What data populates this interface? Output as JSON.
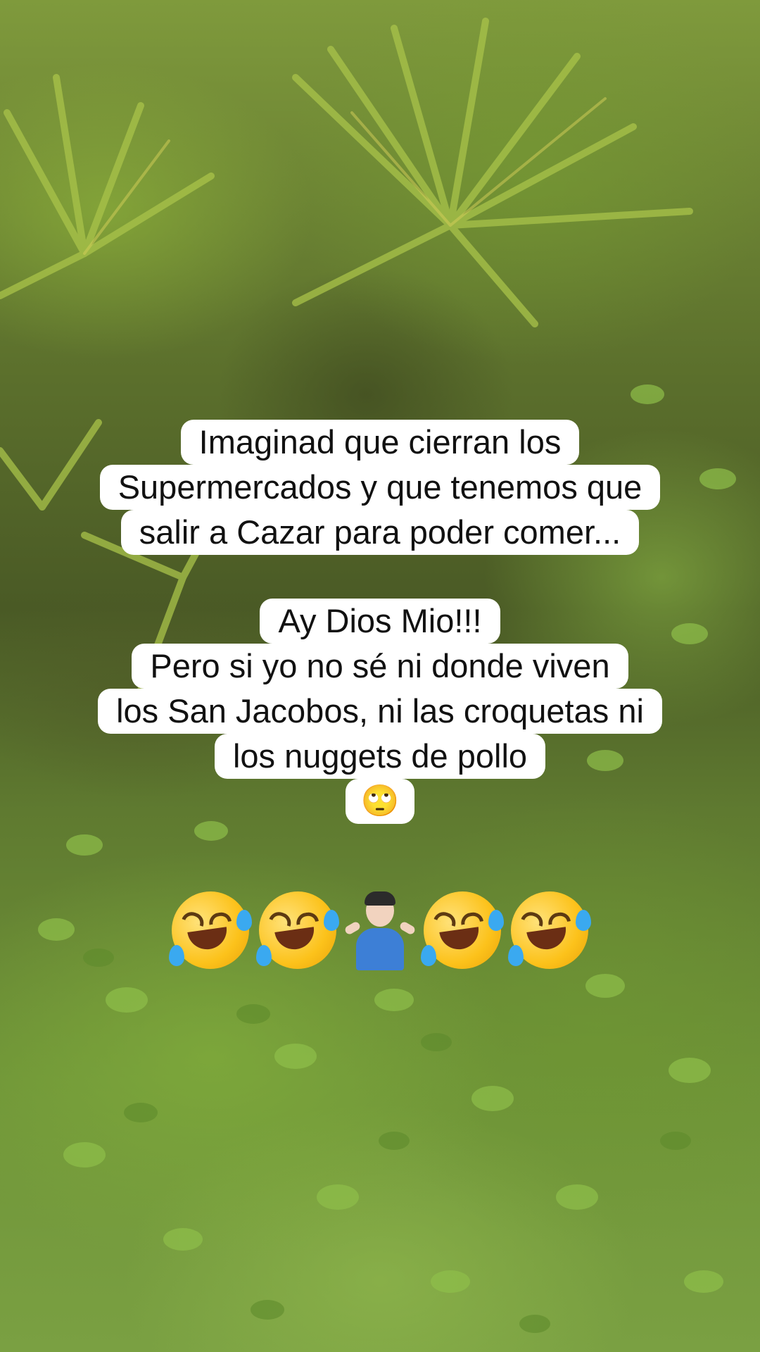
{
  "caption_top": {
    "lines": [
      "Imaginad que cierran los",
      "Supermercados y que tenemos que",
      "salir a Cazar para poder comer..."
    ]
  },
  "caption_bottom": {
    "lines": [
      "Ay Dios Mio!!!",
      "Pero si yo no sé ni donde viven",
      "los San Jacobos, ni las croquetas ni",
      "los nuggets de pollo"
    ],
    "emoji": "🙄"
  },
  "emoji_row": {
    "items": [
      "rofl-emoji",
      "rofl-emoji",
      "man-shrugging-emoji",
      "rofl-emoji",
      "rofl-emoji"
    ]
  },
  "background": {
    "description_colors": {
      "foliage": "#7aa042",
      "shade": "#4a5a25",
      "text_box": "#ffffff",
      "text": "#111111"
    }
  }
}
